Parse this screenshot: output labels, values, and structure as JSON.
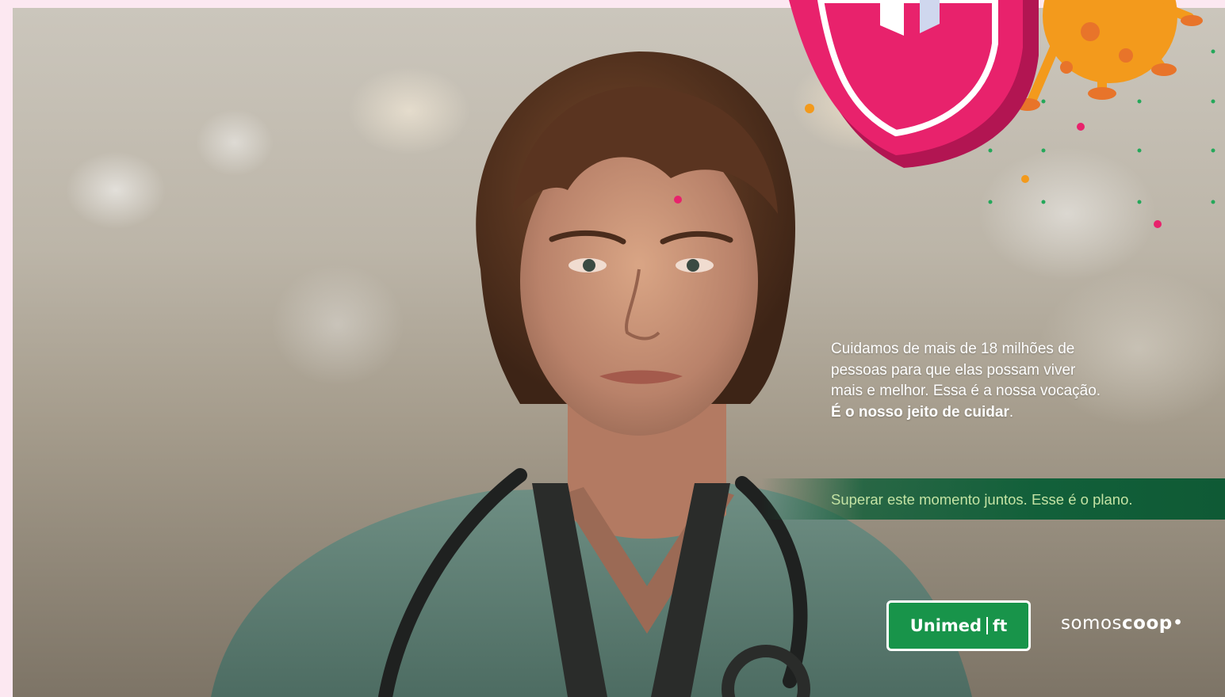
{
  "copy": {
    "line1": "Cuidamos de mais de 18 milhões de",
    "line2": "pessoas para que elas possam viver",
    "line3": "mais e melhor. Essa é a nossa vocação.",
    "line4": "É o nosso jeito de cuidar",
    "line4_end": "."
  },
  "tagline": "Superar este momento juntos. Esse é o plano.",
  "logo": {
    "brand": "Unimed",
    "mark": "ft"
  },
  "coop": {
    "light": "somos",
    "bold": "coop",
    "dot": "•"
  },
  "colors": {
    "page_background": "#fce8f1",
    "shield_pink": "#e8226c",
    "virus_orange": "#f39a1c",
    "bar_green": "#12603a",
    "logo_green": "#18944a",
    "tagline_green": "#c4e3a4"
  },
  "icons": [
    "shield-icon",
    "virus-icon"
  ]
}
